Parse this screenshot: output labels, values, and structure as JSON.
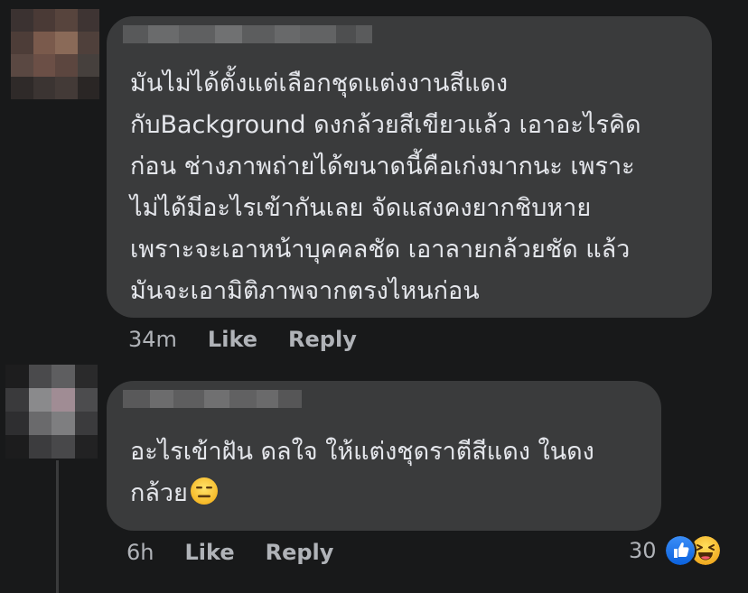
{
  "comments": [
    {
      "text_lines": [
        "มันไม่ได้ตั้งแต่เลือกชุดแต่งงานสีแดง",
        "กับBackground ดงกล้วยสีเขียวแล้ว เอาอะไรคิด",
        "ก่อน ช่างภาพถ่ายได้ขนาดนี้คือเก่งมากนะ เพราะ",
        "ไม่ได้มีอะไรเข้ากันเลย จัดแสงคงยากชิบหาย",
        "เพราะจะเอาหน้าบุคคลชัด เอาลายกล้วยชัด แล้ว",
        "มันจะเอามิติภาพจากตรงไหนก่อน"
      ],
      "time": "34m",
      "like_label": "Like",
      "reply_label": "Reply"
    },
    {
      "text_lines": [
        "อะไรเข้าฝัน ดลใจ ให้แต่งชุดราตีสีแดง ในดง",
        "กล้วย"
      ],
      "emoji": "expressionless-face-icon",
      "time": "6h",
      "like_label": "Like",
      "reply_label": "Reply",
      "reaction_count": "30",
      "reaction_icons": [
        "like-reaction-icon",
        "haha-reaction-icon"
      ]
    }
  ],
  "colors": {
    "background": "#18191a",
    "bubble": "#3a3b3c",
    "text": "#e4e6eb",
    "secondary_text": "#b0b3b8",
    "like_blue": "#1877f2",
    "haha_yellow": "#f7b928"
  }
}
